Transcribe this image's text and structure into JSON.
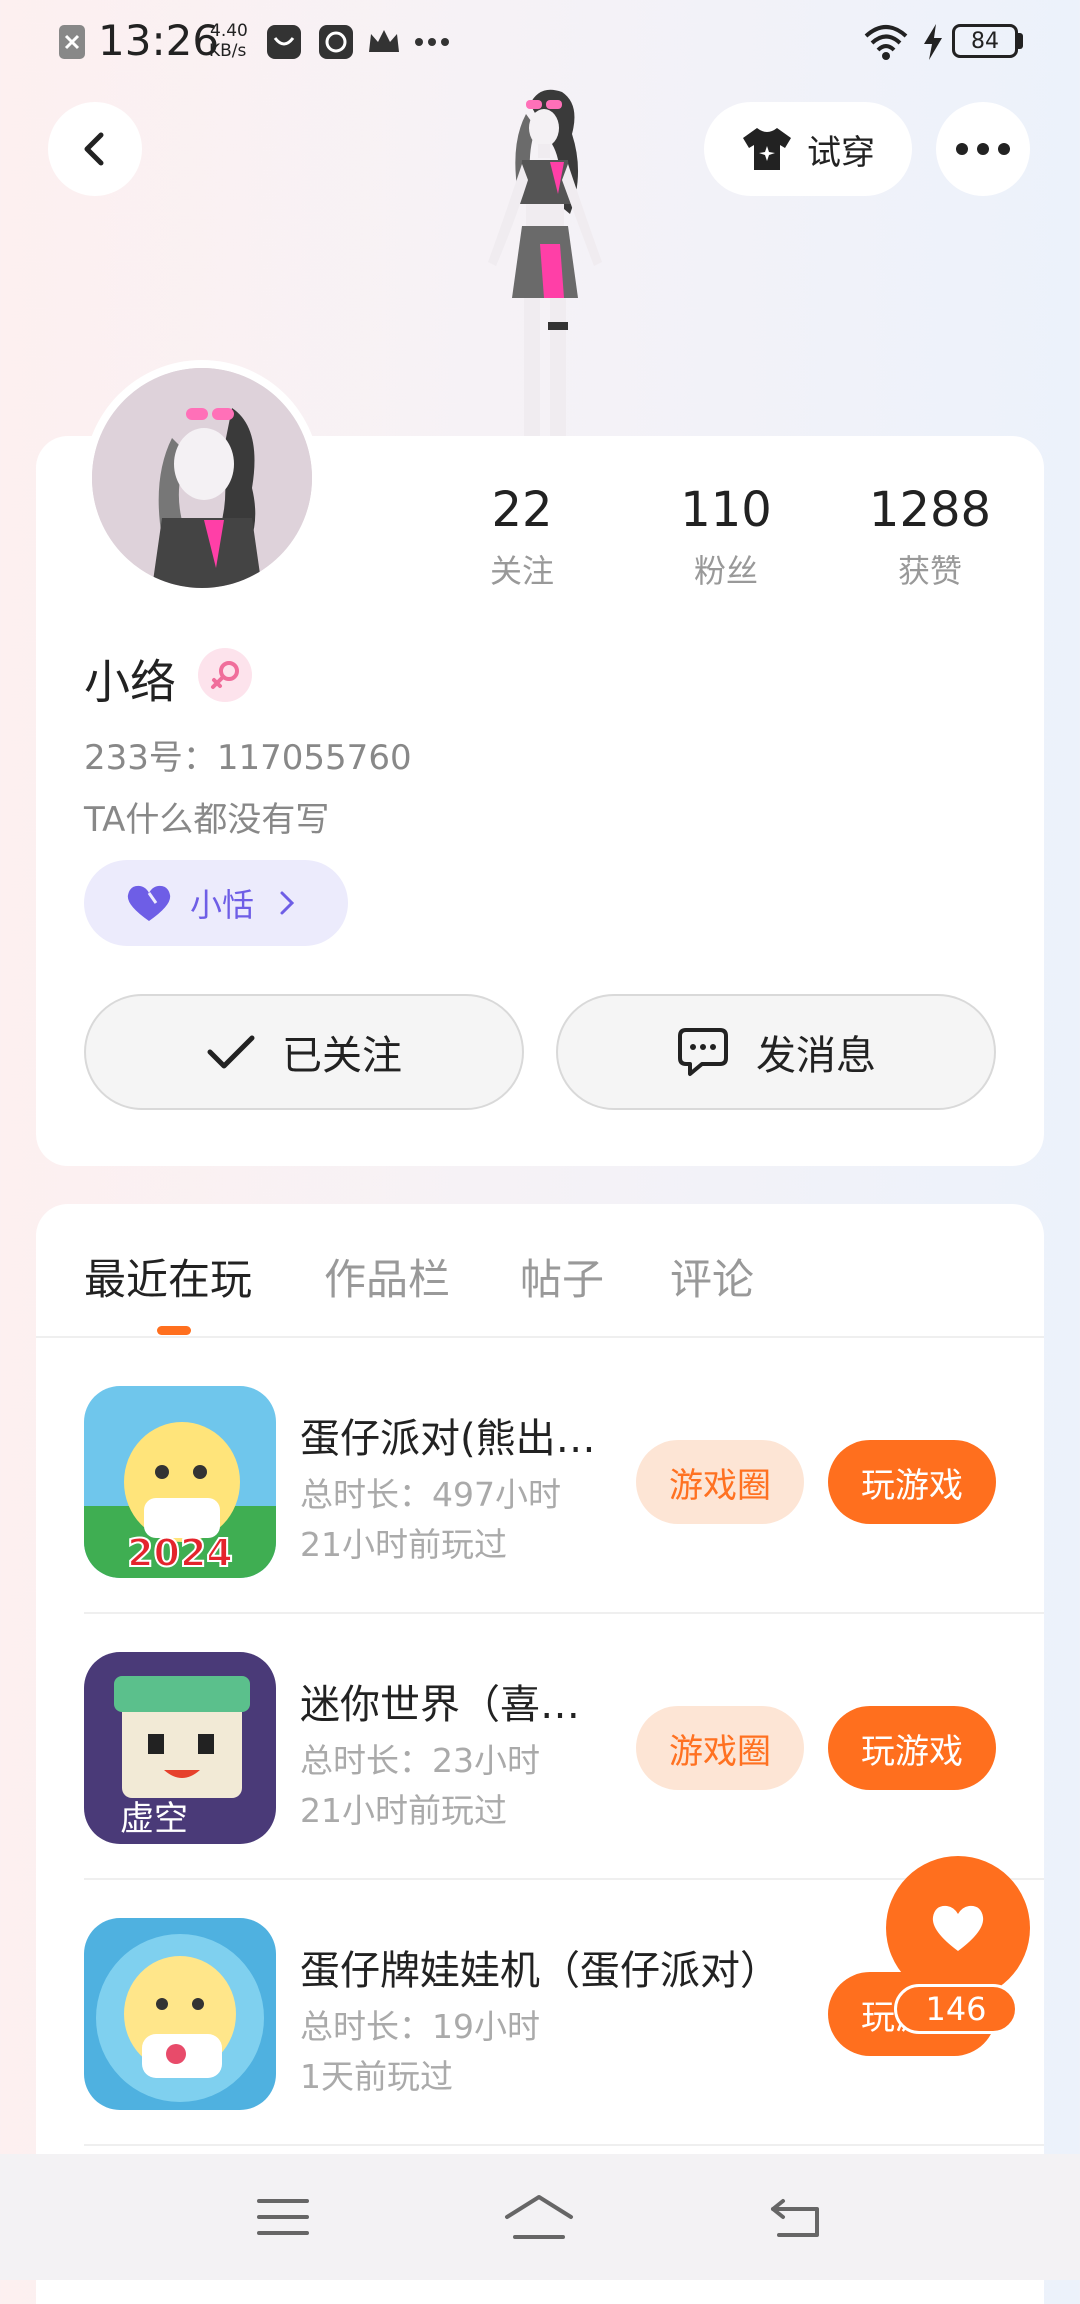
{
  "status_bar": {
    "time": "13:26",
    "net_speed_value": "4.40",
    "net_speed_unit": "KB/s",
    "battery": "84"
  },
  "top_bar": {
    "try_on_label": "试穿"
  },
  "profile": {
    "stats": [
      {
        "value": "22",
        "label": "关注"
      },
      {
        "value": "110",
        "label": "粉丝"
      },
      {
        "value": "1288",
        "label": "获赞"
      }
    ],
    "name": "小络",
    "gender": "female",
    "id_line": "233号：117055760",
    "bio": "TA什么都没有写",
    "tag_label": "小恬",
    "follow_label": "已关注",
    "message_label": "发消息"
  },
  "tabs": [
    "最近在玩",
    "作品栏",
    "帖子",
    "评论"
  ],
  "games": [
    {
      "title": "蛋仔派对(熊出…",
      "duration": "总时长：497小时",
      "last_played": "21小时前玩过",
      "icon_badge": "2024",
      "circle_label": "游戏圈",
      "play_label": "玩游戏"
    },
    {
      "title": "迷你世界（喜…",
      "duration": "总时长：23小时",
      "last_played": "21小时前玩过",
      "icon_badge": "虚空",
      "circle_label": "游戏圈",
      "play_label": "玩游戏"
    },
    {
      "title": "蛋仔牌娃娃机（蛋仔派对）",
      "duration": "总时长：19小时",
      "last_played": "1天前玩过",
      "play_label": "玩游戏"
    }
  ],
  "like_count": "146",
  "colors": {
    "accent": "#ff6f1e",
    "accent_light": "#fde5d5",
    "tag_bg": "#ecebfc",
    "tag_fg": "#6e5ee6"
  }
}
